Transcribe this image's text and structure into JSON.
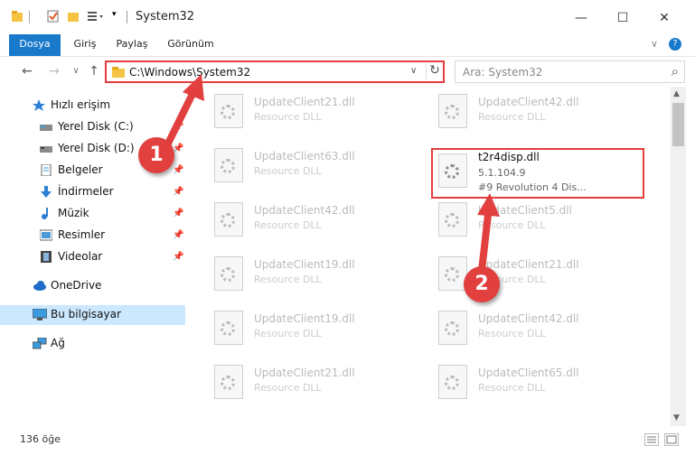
{
  "window": {
    "title": "System32",
    "minimize": "—",
    "maximize": "☐",
    "close": "✕"
  },
  "ribbon": {
    "tabs": [
      "Dosya",
      "Giriş",
      "Paylaş",
      "Görünüm"
    ],
    "expand": "∨",
    "help": "?"
  },
  "nav": {
    "back": "←",
    "forward": "→",
    "recent": "∨",
    "up": "↑",
    "address": "C:\\Windows\\System32",
    "address_dropdown": "∨",
    "refresh": "↻",
    "search_placeholder": "Ara: System32",
    "search_icon": "⌕"
  },
  "sidebar": {
    "items": [
      {
        "label": "Hızlı erişim",
        "icon": "star-icon"
      },
      {
        "label": "Yerel Disk (C:)",
        "icon": "drive-icon"
      },
      {
        "label": "Yerel Disk (D:)",
        "icon": "drive-icon"
      },
      {
        "label": "Belgeler",
        "icon": "documents-icon"
      },
      {
        "label": "İndirmeler",
        "icon": "download-icon"
      },
      {
        "label": "Müzik",
        "icon": "music-icon"
      },
      {
        "label": "Resimler",
        "icon": "pictures-icon"
      },
      {
        "label": "Videolar",
        "icon": "video-icon"
      },
      {
        "label": "OneDrive",
        "icon": "cloud-icon"
      },
      {
        "label": "Bu bilgisayar",
        "icon": "computer-icon"
      },
      {
        "label": "Ağ",
        "icon": "network-icon"
      }
    ],
    "pin_glyph": "📌"
  },
  "files": [
    {
      "name": "UpdateClient21.dll",
      "type": "Resource DLL"
    },
    {
      "name": "UpdateClient42.dll",
      "type": "Resource DLL"
    },
    {
      "name": "UpdateClient63.dll",
      "type": "Resource DLL"
    },
    {
      "name": "t2r4disp.dll",
      "type": "5.1.104.9",
      "desc": "#9 Revolution 4 Dis..."
    },
    {
      "name": "UpdateClient42.dll",
      "type": "Resource DLL"
    },
    {
      "name": "UpdateClient5.dll",
      "type": "Resource DLL"
    },
    {
      "name": "UpdateClient19.dll",
      "type": "Resource DLL"
    },
    {
      "name": "UpdateClient21.dll",
      "type": "Resource DLL"
    },
    {
      "name": "UpdateClient19.dll",
      "type": "Resource DLL"
    },
    {
      "name": "UpdateClient42.dll",
      "type": "Resource DLL"
    },
    {
      "name": "UpdateClient21.dll",
      "type": "Resource DLL"
    },
    {
      "name": "UpdateClient65.dll",
      "type": "Resource DLL"
    }
  ],
  "status": {
    "count": "136 öğe"
  },
  "annotations": {
    "step1": "1",
    "step2": "2",
    "color": "#e23f3f"
  },
  "colors": {
    "accent": "#1979ca",
    "selection": "#cce8ff",
    "highlight_border": "#e53d3d"
  }
}
